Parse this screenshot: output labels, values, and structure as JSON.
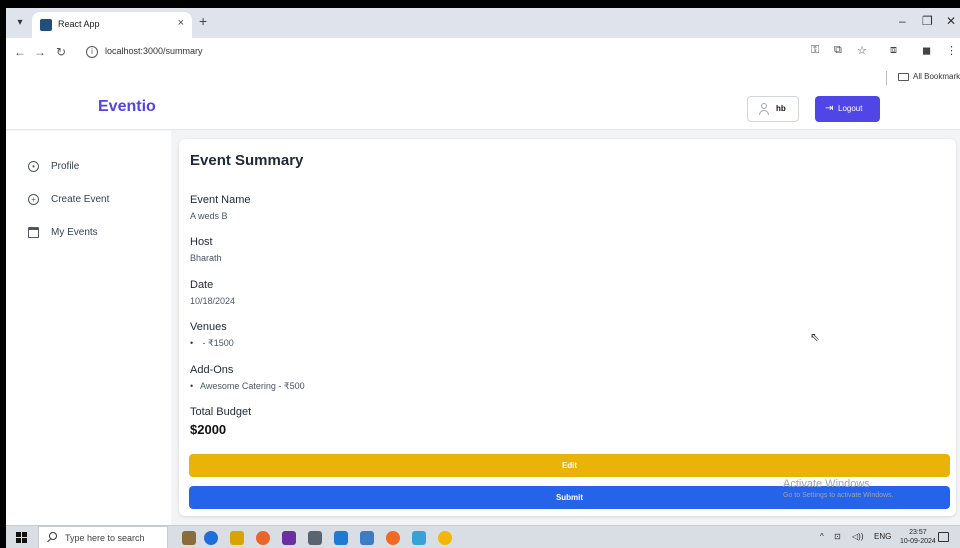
{
  "browser": {
    "tab_title": "React App",
    "tab_close": "×",
    "new_tab": "+",
    "url": "localhost:3000/summary",
    "bookmarks_label": "All Bookmarks"
  },
  "app": {
    "logo": "Eventio",
    "user_name": "hb",
    "logout_label": "Logout"
  },
  "sidebar": {
    "items": [
      {
        "label": "Profile",
        "icon": "profile-icon"
      },
      {
        "label": "Create Event",
        "icon": "plus-circle-icon"
      },
      {
        "label": "My Events",
        "icon": "calendar-icon"
      }
    ]
  },
  "summary": {
    "title": "Event Summary",
    "event_name_label": "Event Name",
    "event_name": "A weds B",
    "host_label": "Host",
    "host": "Bharath",
    "date_label": "Date",
    "date": "10/18/2024",
    "venues_label": "Venues",
    "venues": [
      " - ₹1500"
    ],
    "addons_label": "Add-Ons",
    "addons": [
      "Awesome Catering - ₹500"
    ],
    "total_label": "Total Budget",
    "total": "$2000",
    "edit_label": "Edit",
    "submit_label": "Submit"
  },
  "watermark": {
    "title": "Activate Windows",
    "subtitle": "Go to Settings to activate Windows."
  },
  "taskbar": {
    "search_placeholder": "Type here to search",
    "language": "ENG",
    "time": "23:57",
    "date": "10-09-2024"
  },
  "colors": {
    "brand": "#4f46e5",
    "edit": "#eab308",
    "submit": "#2563eb"
  }
}
